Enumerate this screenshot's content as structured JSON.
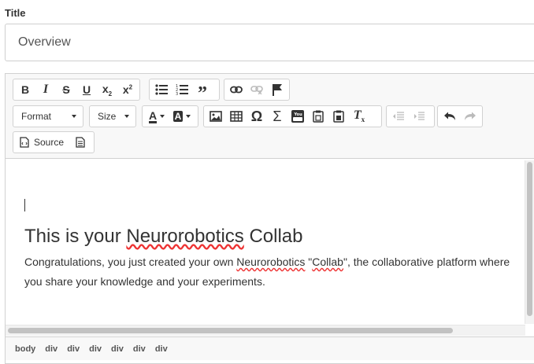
{
  "title_field": {
    "label": "Title",
    "value": "Overview"
  },
  "toolbar": {
    "row1_basic": [
      "bold-icon",
      "italic-icon",
      "strikethrough-icon",
      "underline-icon",
      "subscript-icon",
      "superscript-icon"
    ],
    "row1_list": [
      "bulleted-list-icon",
      "numbered-list-icon",
      "blockquote-icon"
    ],
    "row1_link": [
      "link-icon",
      "unlink-icon",
      "anchor-flag-icon"
    ],
    "format_label": "Format",
    "size_label": "Size",
    "source_label": "Source"
  },
  "content": {
    "heading_pre": "This is your ",
    "heading_spell": "Neurorobotics",
    "heading_post": " Collab",
    "para_1": "Congratulations, you just created your own ",
    "para_spell_1": "Neurorobotics",
    "para_2": " \"",
    "para_spell_2": "Collab",
    "para_3": "\", the collaborative platform where you share your knowledge and your experiments."
  },
  "pathbar": {
    "crumbs": [
      "body",
      "div",
      "div",
      "div",
      "div",
      "div",
      "div"
    ]
  },
  "colors": {
    "toolbar_bg": "#f8f8f8",
    "border": "#d1d1d1",
    "spellcheck": "#e33333"
  }
}
